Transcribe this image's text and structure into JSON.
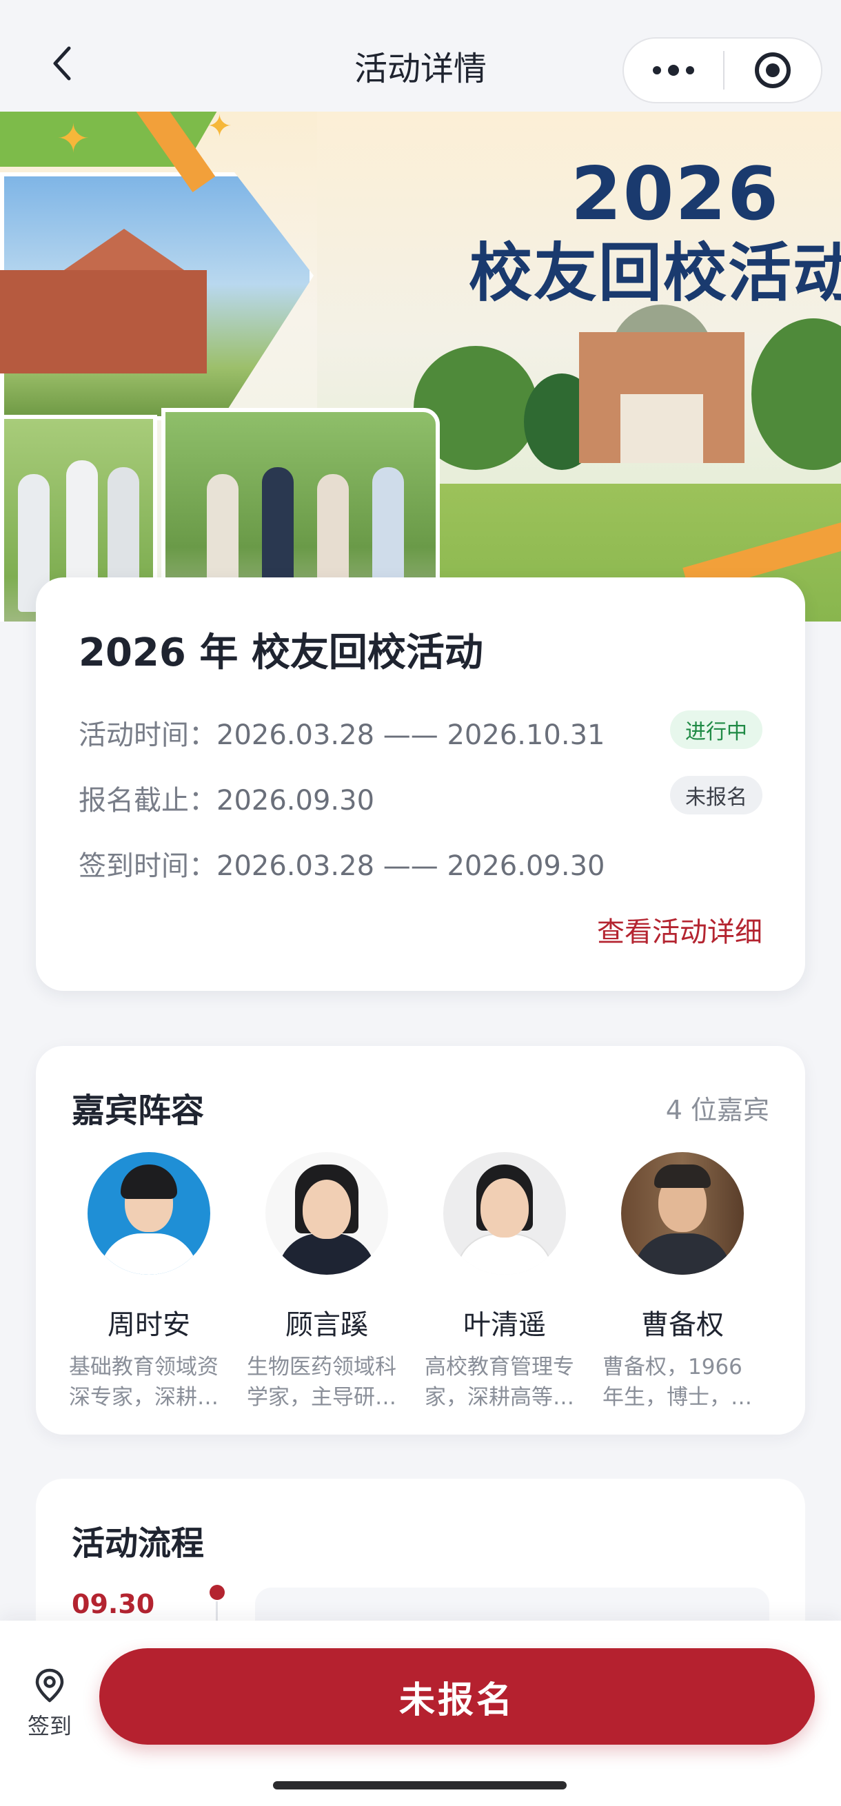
{
  "nav": {
    "title": "活动详情",
    "back_icon": "chevron-left-icon",
    "more_icon": "more-dots-icon",
    "close_icon": "target-circle-icon"
  },
  "banner": {
    "year": "2026",
    "title": "校友回校活动"
  },
  "info": {
    "title": "2026 年 校友回校活动",
    "activity_time_label": "活动时间：",
    "activity_time_value": "2026.03.28 —— 2026.10.31",
    "status_badge": "进行中",
    "deadline_label": "报名截止：",
    "deadline_value": "2026.09.30",
    "registration_badge": "未报名",
    "checkin_time_label": "签到时间：",
    "checkin_time_value": "2026.03.28 —— 2026.09.30",
    "detail_link": "查看活动详细"
  },
  "guests": {
    "title": "嘉宾阵容",
    "count": "4 位嘉宾",
    "items": [
      {
        "name": "周时安",
        "desc": "基础教育领域资深专家，深耕…"
      },
      {
        "name": "顾言蹊",
        "desc": "生物医药领域科学家，主导研…"
      },
      {
        "name": "叶清遥",
        "desc": "高校教育管理专家，深耕高等…"
      },
      {
        "name": "曹备权",
        "desc": "曹备权，1966年生，博士，…"
      }
    ]
  },
  "schedule": {
    "title": "活动流程",
    "first_date": "09.30"
  },
  "bottom": {
    "checkin_label": "签到",
    "checkin_icon": "location-pin-icon",
    "cta_label": "未报名"
  },
  "colors": {
    "accent": "#b5212f",
    "banner_title": "#1a3a6e",
    "status_green": "#1f8a45"
  }
}
